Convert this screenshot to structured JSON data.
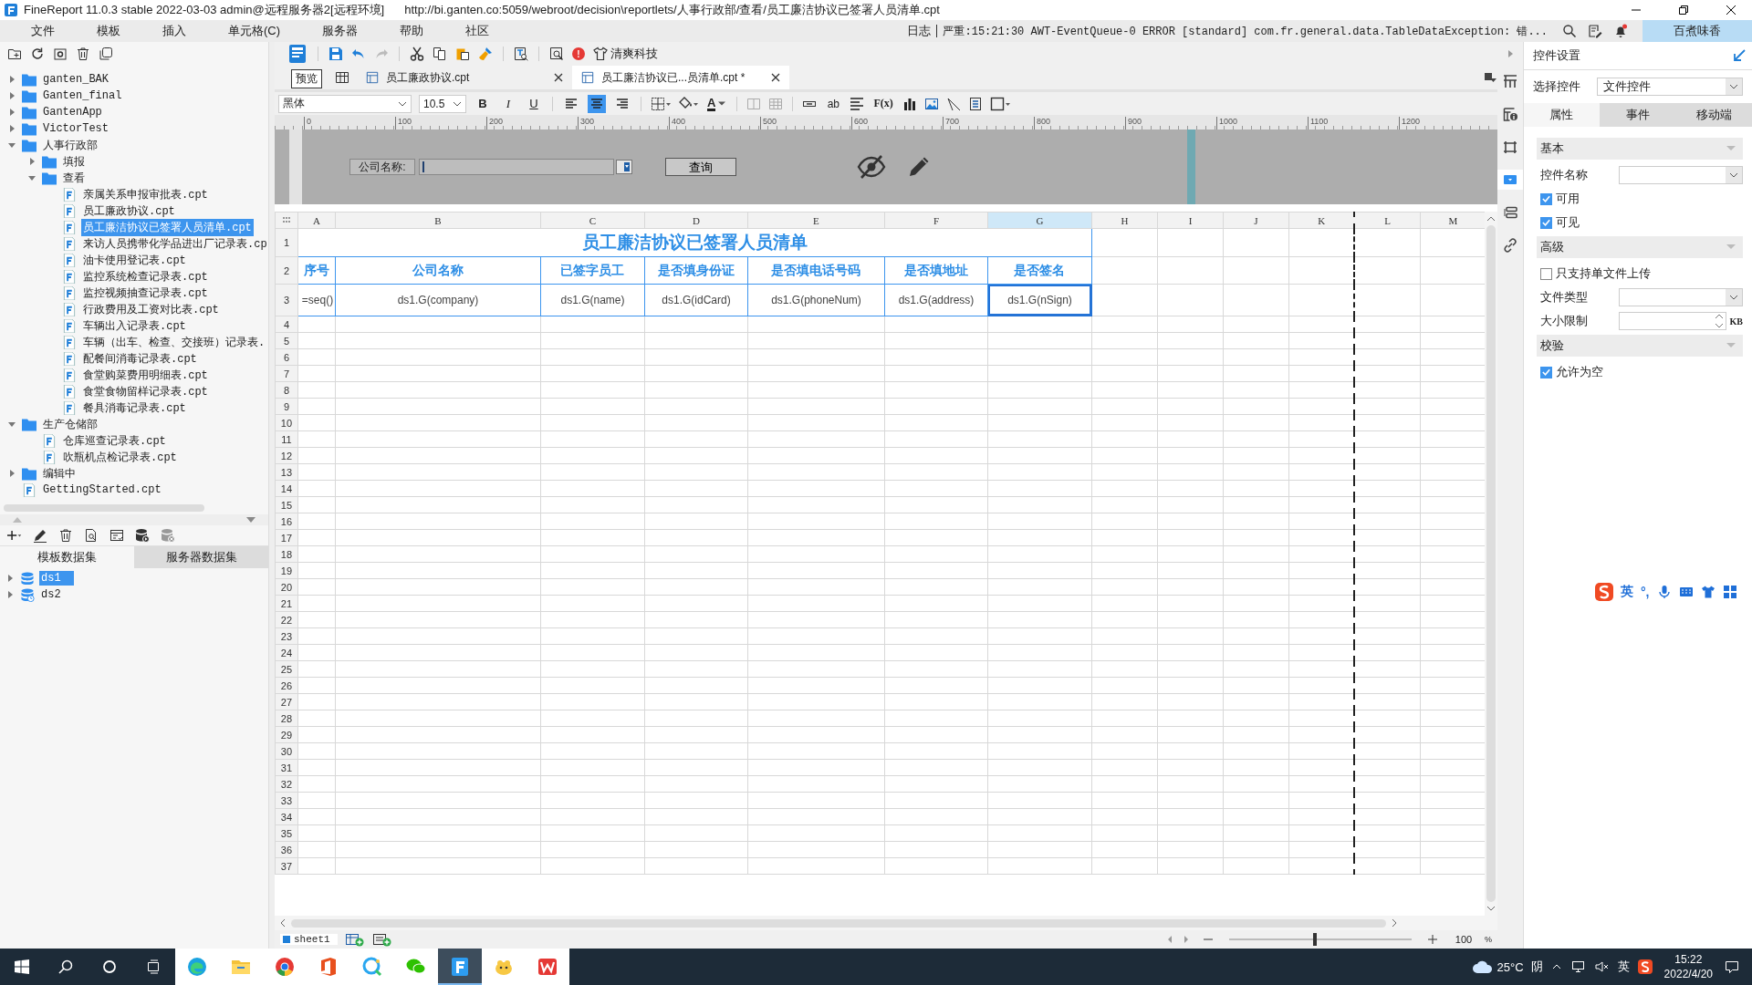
{
  "window": {
    "title": "FineReport 11.0.3 stable 2022-03-03 admin@远程服务器2[远程环境]",
    "url": "http://bi.ganten.co:5059/webroot/decision\\reportlets/人事行政部/查看/员工廉洁协议已签署人员清单.cpt"
  },
  "menu": [
    "文件",
    "模板",
    "插入",
    "单元格(C)",
    "服务器",
    "帮助",
    "社区"
  ],
  "log": {
    "label": "日志",
    "message": "严重:15:21:30 AWT-EventQueue-0 ERROR [standard] com.fr.general.data.TableDataException: 错..."
  },
  "notifications": {
    "unread": true
  },
  "user": "百煮味香",
  "tree": [
    {
      "name": "ganten_BAK",
      "kind": "folder",
      "expanded": false,
      "selected": false
    },
    {
      "name": "Ganten_final",
      "kind": "folder",
      "expanded": false,
      "selected": false
    },
    {
      "name": "GantenApp",
      "kind": "folder",
      "expanded": false,
      "selected": false
    },
    {
      "name": "VictorTest",
      "kind": "folder",
      "expanded": false,
      "selected": false
    },
    {
      "name": "人事行政部",
      "kind": "folder",
      "expanded": true,
      "selected": false,
      "children": [
        {
          "name": "填报",
          "kind": "folder",
          "expanded": false,
          "selected": false
        },
        {
          "name": "查看",
          "kind": "folder",
          "expanded": true,
          "selected": false,
          "children": [
            {
              "name": "亲属关系申报审批表.cpt",
              "kind": "file",
              "selected": false
            },
            {
              "name": "员工廉政协议.cpt",
              "kind": "file",
              "selected": false
            },
            {
              "name": "员工廉洁协议已签署人员清单.cpt",
              "kind": "file",
              "selected": true
            },
            {
              "name": "来访人员携带化学品进出厂记录表.cp",
              "kind": "file",
              "selected": false
            },
            {
              "name": "油卡使用登记表.cpt",
              "kind": "file",
              "selected": false
            },
            {
              "name": "监控系统检查记录表.cpt",
              "kind": "file",
              "selected": false
            },
            {
              "name": "监控视频抽查记录表.cpt",
              "kind": "file",
              "selected": false
            },
            {
              "name": "行政费用及工资对比表.cpt",
              "kind": "file",
              "selected": false
            },
            {
              "name": "车辆出入记录表.cpt",
              "kind": "file",
              "selected": false
            },
            {
              "name": "车辆（出车、检查、交接班）记录表.",
              "kind": "file",
              "selected": false
            },
            {
              "name": "配餐间消毒记录表.cpt",
              "kind": "file",
              "selected": false
            },
            {
              "name": "食堂购菜费用明细表.cpt",
              "kind": "file",
              "selected": false
            },
            {
              "name": "食堂食物留样记录表.cpt",
              "kind": "file",
              "selected": false
            },
            {
              "name": "餐具消毒记录表.cpt",
              "kind": "file",
              "selected": false
            }
          ]
        }
      ]
    },
    {
      "name": "生产仓储部",
      "kind": "folder",
      "expanded": true,
      "selected": false,
      "children": [
        {
          "name": "仓库巡查记录表.cpt",
          "kind": "file",
          "selected": false
        },
        {
          "name": "吹瓶机点检记录表.cpt",
          "kind": "file",
          "selected": false
        }
      ]
    },
    {
      "name": "编辑中",
      "kind": "folder",
      "expanded": false,
      "selected": false
    },
    {
      "name": "GettingStarted.cpt",
      "kind": "file",
      "selected": false
    }
  ],
  "datasets": {
    "tabs": [
      {
        "label": "模板数据集",
        "selected": true
      },
      {
        "label": "服务器数据集",
        "selected": false
      }
    ],
    "items": [
      {
        "name": "ds1",
        "kind": "plain",
        "selected": true
      },
      {
        "name": "ds2",
        "kind": "scheduled",
        "selected": false
      }
    ]
  },
  "toolbar": {
    "alert_badge": "!",
    "brand": "清爽科技"
  },
  "tooltip": "预览",
  "editor_tabs": [
    {
      "label": "员工廉政协议.cpt",
      "selected": false
    },
    {
      "label": "员工廉洁协议已...员清单.cpt *",
      "selected": true
    }
  ],
  "format": {
    "font": "黑体",
    "size": "10.5",
    "bold": "B",
    "italic": "I",
    "underline": "U",
    "alignment": [
      {
        "selected": false
      },
      {
        "selected": true
      },
      {
        "selected": false
      }
    ],
    "font_color": "A",
    "wrap": "ab",
    "formula": "F(x)"
  },
  "ruler": [
    "0",
    "100",
    "200",
    "300",
    "400",
    "500",
    "600",
    "700",
    "800",
    "900",
    "1000",
    "1100",
    "1200"
  ],
  "parameters": {
    "label": "公司名称:",
    "query_button": "查询"
  },
  "sheet": {
    "columns": [
      {
        "label": "A",
        "selected": false,
        "page_break": false
      },
      {
        "label": "B",
        "selected": false,
        "page_break": false
      },
      {
        "label": "C",
        "selected": false,
        "page_break": false
      },
      {
        "label": "D",
        "selected": false,
        "page_break": false
      },
      {
        "label": "E",
        "selected": false,
        "page_break": false
      },
      {
        "label": "F",
        "selected": false,
        "page_break": false
      },
      {
        "label": "G",
        "selected": true,
        "page_break": false
      },
      {
        "label": "H",
        "selected": false,
        "page_break": false
      },
      {
        "label": "I",
        "selected": false,
        "page_break": false
      },
      {
        "label": "J",
        "selected": false,
        "page_break": false
      },
      {
        "label": "K",
        "selected": false,
        "page_break": false
      },
      {
        "label": "L",
        "selected": false,
        "page_break": true
      },
      {
        "label": "M",
        "selected": false,
        "page_break": false
      }
    ],
    "title": "员工廉洁协议已签署人员清单",
    "headers": [
      "序号",
      "公司名称",
      "已签字员工",
      "是否填身份证",
      "是否填电话号码",
      "是否填地址",
      "是否签名"
    ],
    "formulas": [
      {
        "text": "=seq()",
        "selected": false
      },
      {
        "text": "ds1.G(company)",
        "selected": false
      },
      {
        "text": "ds1.G(name)",
        "selected": false
      },
      {
        "text": "ds1.G(idCard)",
        "selected": false
      },
      {
        "text": "ds1.G(phoneNum)",
        "selected": false
      },
      {
        "text": "ds1.G(address)",
        "selected": false
      },
      {
        "text": "ds1.G(nSign)",
        "selected": true
      }
    ],
    "row_numbers": [
      "1",
      "2",
      "3",
      "4",
      "5",
      "6",
      "7",
      "8",
      "9",
      "10",
      "11",
      "12",
      "13",
      "14",
      "15",
      "16",
      "17",
      "18",
      "19",
      "20",
      "21",
      "22",
      "23",
      "24",
      "25",
      "26",
      "27",
      "28",
      "29",
      "30",
      "31",
      "32",
      "33",
      "34",
      "35",
      "36",
      "37"
    ]
  },
  "sheet_tabs": [
    {
      "label": "sheet1",
      "selected": true
    }
  ],
  "zoom": {
    "level": 0.47,
    "value": "100",
    "unit": "%"
  },
  "side_icons": [
    {
      "kind": "grid",
      "selected": false
    },
    {
      "kind": "info",
      "selected": false
    },
    {
      "kind": "frame",
      "selected": false
    },
    {
      "kind": "widget",
      "selected": true
    },
    {
      "kind": "layout",
      "selected": false
    },
    {
      "kind": "link",
      "selected": false
    }
  ],
  "widget_panel": {
    "title": "控件设置",
    "select_label": "选择控件",
    "select_value": "文件控件",
    "tabs": [
      {
        "label": "属性",
        "selected": true
      },
      {
        "label": "事件",
        "selected": false
      },
      {
        "label": "移动端",
        "selected": false
      }
    ],
    "sections": [
      {
        "title": "基本",
        "rows": [
          {
            "kind": "combo",
            "label": "控件名称"
          },
          {
            "kind": "checkbox",
            "label": "可用",
            "checked": true
          },
          {
            "kind": "checkbox",
            "label": "可见",
            "checked": true
          }
        ]
      },
      {
        "title": "高级",
        "rows": [
          {
            "kind": "checkbox",
            "label": "只支持单文件上传",
            "checked": false
          },
          {
            "kind": "combo",
            "label": "文件类型"
          },
          {
            "kind": "spinner",
            "label": "大小限制",
            "unit": "KB"
          }
        ]
      },
      {
        "title": "校验",
        "rows": [
          {
            "kind": "checkbox",
            "label": "允许为空",
            "checked": true
          }
        ]
      }
    ]
  },
  "ime": {
    "mode": "英",
    "punct": "°,"
  },
  "taskbar": {
    "apps": [
      {
        "kind": "edge",
        "active": false
      },
      {
        "kind": "folder",
        "active": false
      },
      {
        "kind": "chrome",
        "active": false
      },
      {
        "kind": "office",
        "active": false
      },
      {
        "kind": "search",
        "active": false
      },
      {
        "kind": "chat",
        "active": false
      },
      {
        "kind": "report",
        "active": true
      },
      {
        "kind": "bird",
        "active": false
      },
      {
        "kind": "wps",
        "active": false
      }
    ],
    "weather": "25°C",
    "condition": "阴",
    "ime": "英",
    "time": "15:22",
    "date": "2022/4/20"
  }
}
